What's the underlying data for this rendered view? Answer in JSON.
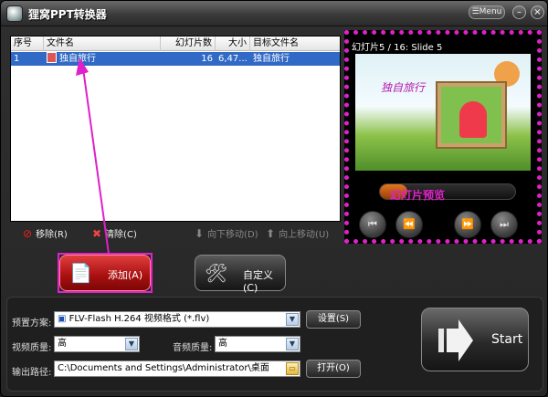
{
  "window": {
    "title": "狸窝PPT转换器",
    "menu_label": "Menu",
    "min_label": "–",
    "close_label": "×"
  },
  "file_list": {
    "columns": [
      "序号",
      "文件名",
      "幻灯片数",
      "大小",
      "目标文件名"
    ],
    "rows": [
      {
        "index": "1",
        "name": "独自旅行",
        "slides": "16",
        "size": "6,47...",
        "target": "独自旅行"
      }
    ]
  },
  "list_actions": {
    "remove": "移除(R)",
    "clear": "清除(C)",
    "move_down": "向下移动(D)",
    "move_up": "向上移动(U)"
  },
  "buttons": {
    "add": "添加(A)",
    "custom": "自定义(C)"
  },
  "preview": {
    "title": "幻灯片5 / 16: Slide 5",
    "slide_text": "独自旅行",
    "progress_text": "幻灯片预览",
    "progress": 0.2,
    "controls": [
      "⏮",
      "⏪",
      "⏩",
      "⏭"
    ]
  },
  "settings": {
    "preset_label": "预置方案:",
    "preset_value": "FLV-Flash H.264 视频格式 (*.flv)",
    "settings_btn": "设置(S)",
    "video_quality_label": "视频质量:",
    "video_quality_value": "高",
    "audio_quality_label": "音频质量:",
    "audio_quality_value": "高",
    "output_label": "输出路径:",
    "output_value": "C:\\Documents and Settings\\Administrator\\桌面",
    "open_btn": "打开(O)",
    "start_label": "Start"
  },
  "colors": {
    "highlight_magenta": "#e020c8",
    "selection_blue": "#3169c6",
    "add_red": "#c01818"
  }
}
